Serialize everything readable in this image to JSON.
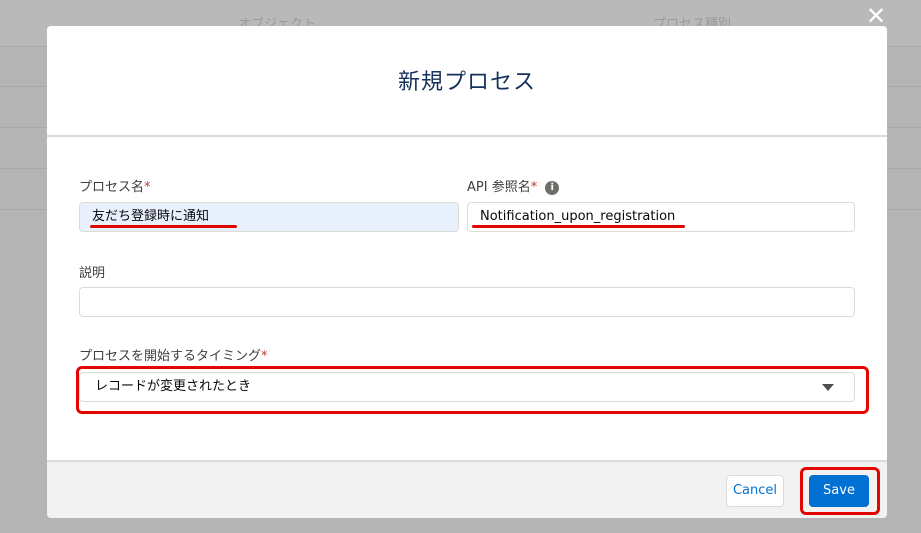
{
  "background": {
    "columns": [
      "オブジェクト",
      "プロセス種別"
    ],
    "close_icon": "close-icon"
  },
  "modal": {
    "title": "新規プロセス",
    "process_name": {
      "label": "プロセス名",
      "required_mark": "*",
      "value": "友だち登録時に通知"
    },
    "api_name": {
      "label": "API 参照名",
      "required_mark": "*",
      "info_icon": "i",
      "value": "Notification_upon_registration"
    },
    "description": {
      "label": "説明",
      "value": ""
    },
    "timing": {
      "label": "プロセスを開始するタイミング",
      "required_mark": "*",
      "selected": "レコードが変更されたとき"
    },
    "footer": {
      "cancel_label": "Cancel",
      "save_label": "Save"
    }
  },
  "colors": {
    "primary": "#0070d2",
    "annotation_red": "#e10600",
    "title_text": "#16325c"
  }
}
